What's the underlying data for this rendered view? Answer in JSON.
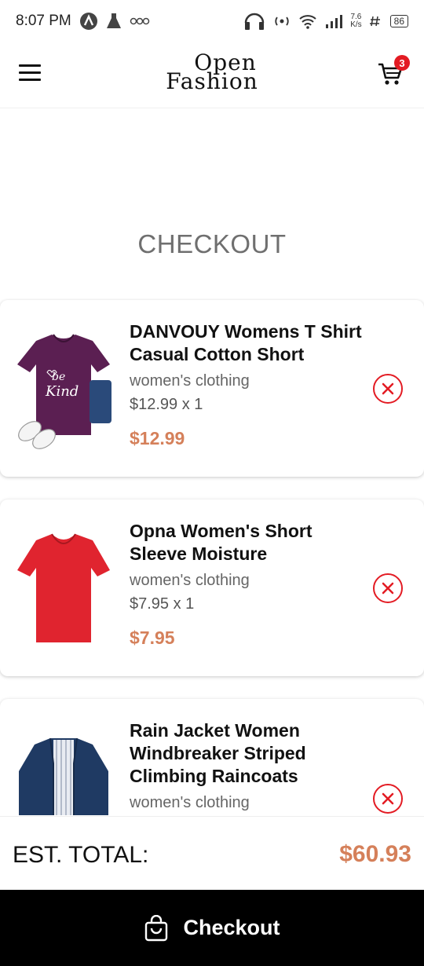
{
  "status_bar": {
    "time": "8:07 PM",
    "network_speed_value": "7.6",
    "network_speed_unit": "K/s",
    "battery": "86",
    "icons": [
      "a-circle-icon",
      "flask-icon",
      "voicemail-icon",
      "headset-icon",
      "hotspot-icon",
      "wifi-icon",
      "signal-icon",
      "volte-icon"
    ]
  },
  "header": {
    "logo_line1": "Open",
    "logo_line2": "Fashion",
    "cart_count": "3",
    "menu_icon": "hamburger-icon",
    "cart_icon": "cart-icon"
  },
  "page": {
    "title": "CHECKOUT"
  },
  "cart": {
    "items": [
      {
        "name": "DANVOUY Womens T Shirt Casual Cotton Short",
        "category": "women's clothing",
        "qty_text": "$12.99 x 1",
        "total": "$12.99",
        "image": "purple-tshirt-thumbnail",
        "shirt_color": "#5b1f52"
      },
      {
        "name": "Opna Women's Short Sleeve Moisture",
        "category": "women's clothing",
        "qty_text": "$7.95 x 1",
        "total": "$7.95",
        "image": "red-tshirt-thumbnail",
        "shirt_color": "#e0242f"
      },
      {
        "name": "Rain Jacket Women Windbreaker Striped Climbing Raincoats",
        "category": "women's clothing",
        "qty_text": "",
        "total": "",
        "image": "navy-jacket-thumbnail",
        "shirt_color": "#1f3a63"
      }
    ]
  },
  "summary": {
    "label": "EST. TOTAL:",
    "value": "$60.93"
  },
  "checkout": {
    "label": "Checkout",
    "icon": "shopping-bag-icon"
  },
  "colors": {
    "accent": "#d5805a",
    "remove": "#e31b23",
    "badge": "#e31b23",
    "checkout_bg": "#000000"
  }
}
